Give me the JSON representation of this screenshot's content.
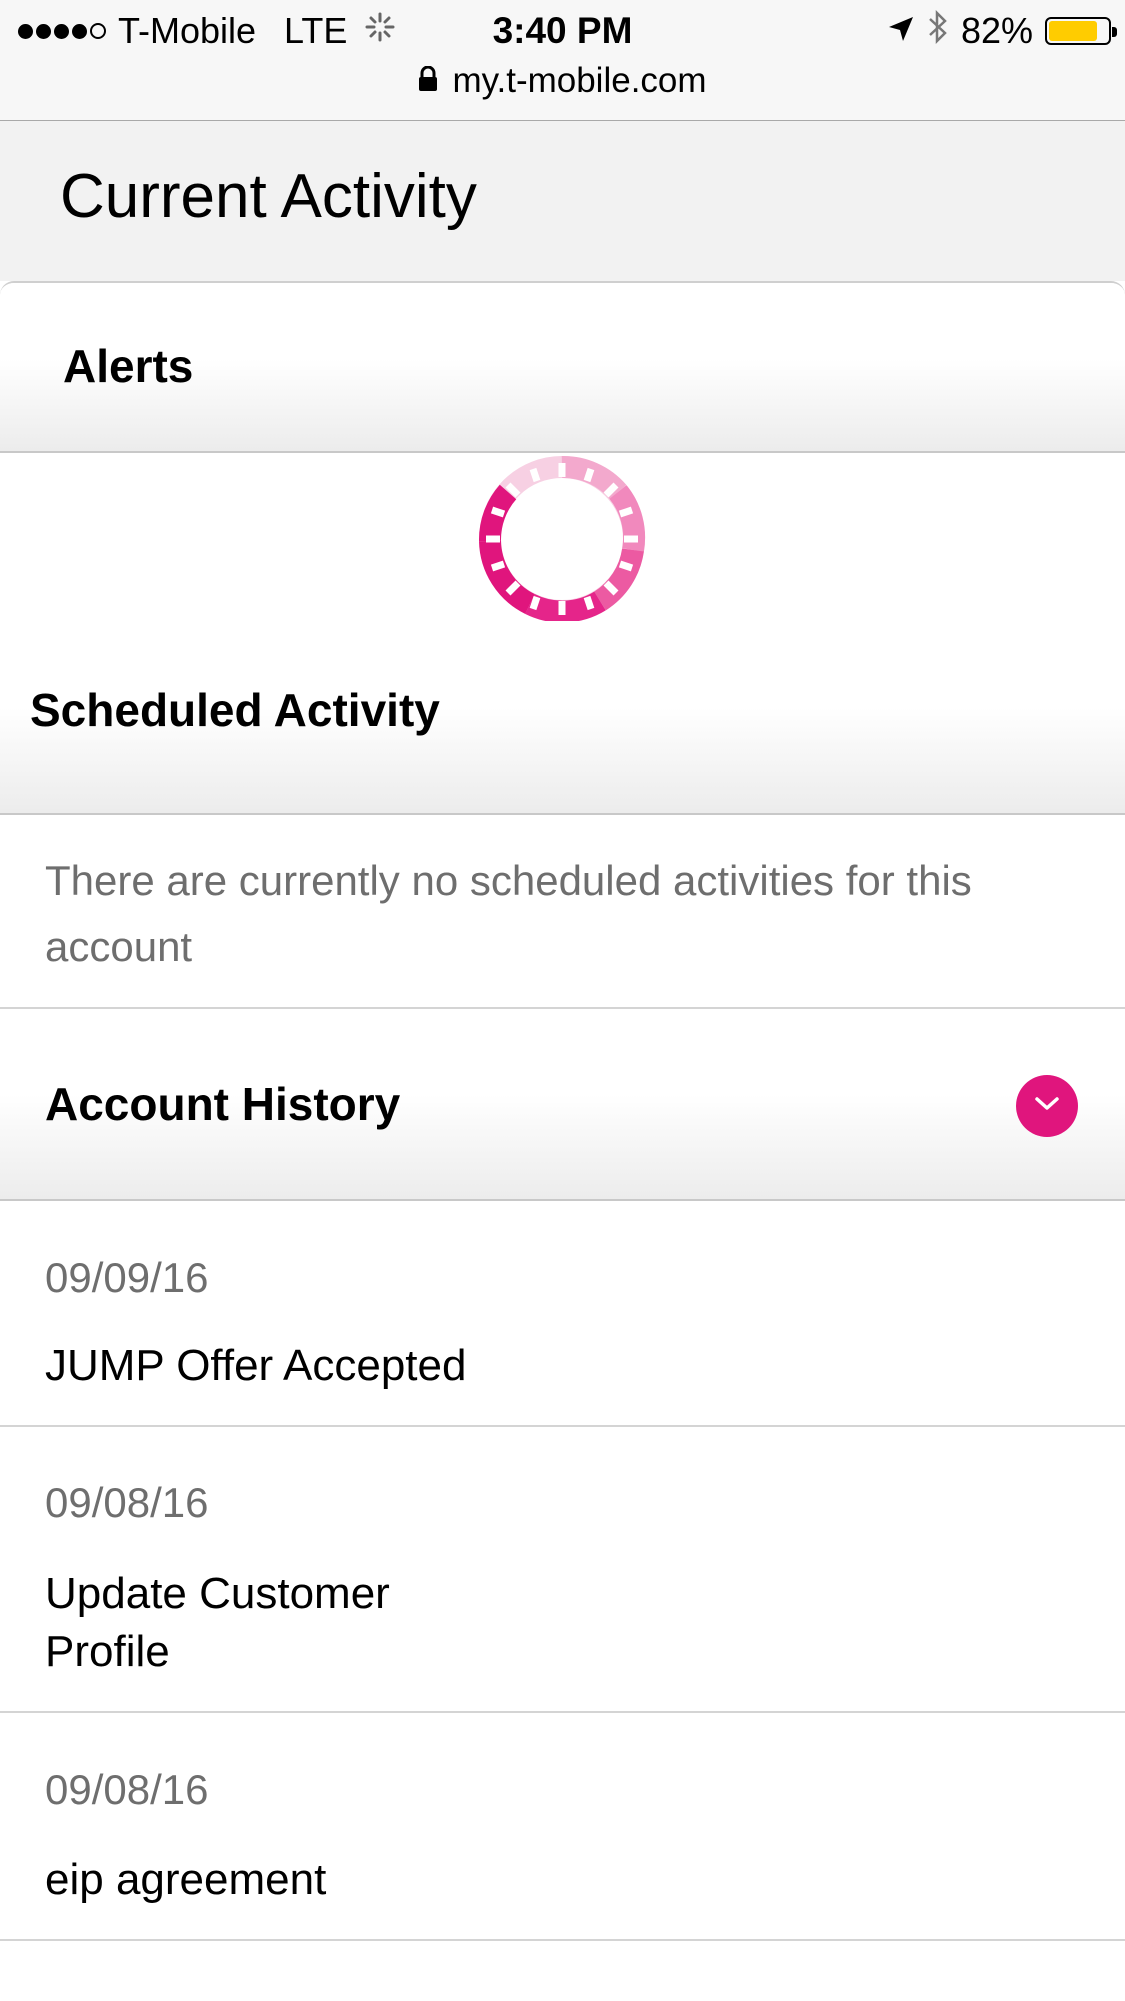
{
  "status_bar": {
    "carrier": "T-Mobile",
    "network": "LTE",
    "time": "3:40 PM",
    "battery_percent": "82%",
    "battery_level": 0.82,
    "battery_color": "#ffcc00",
    "signal_bars_filled": 4,
    "signal_bars_total": 5
  },
  "url_bar": {
    "domain": "my.t-mobile.com"
  },
  "page": {
    "title": "Current Activity"
  },
  "alerts": {
    "title": "Alerts",
    "loading": true
  },
  "scheduled": {
    "title": "Scheduled Activity",
    "empty_message": "There are currently no scheduled activities for this account"
  },
  "history": {
    "title": "Account History",
    "items": [
      {
        "date": "09/09/16",
        "title": "JUMP Offer Accepted"
      },
      {
        "date": "09/08/16",
        "title": "Update Customer Profile"
      },
      {
        "date": "09/08/16",
        "title": "eip agreement"
      }
    ]
  },
  "colors": {
    "accent": "#e0157d",
    "muted_text": "#6e6e6e",
    "header_bg": "#f2f2f2"
  },
  "icons": {
    "lock": "lock-icon",
    "location": "location-arrow-icon",
    "bluetooth": "bluetooth-icon",
    "activity": "activity-spinner-icon",
    "chevron": "chevron-down-icon",
    "loading": "loading-spinner-icon"
  }
}
